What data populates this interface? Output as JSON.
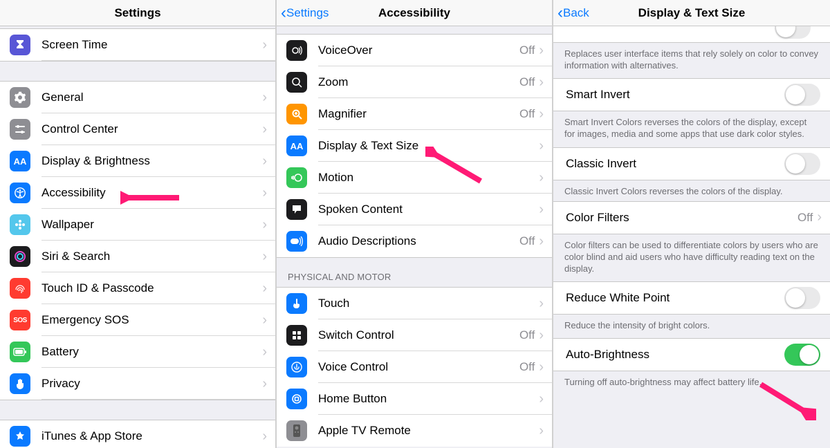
{
  "panes": {
    "settings": {
      "title": "Settings",
      "rows": {
        "screen_time": {
          "label": "Screen Time",
          "icon_bg": "#5856d6"
        },
        "general": {
          "label": "General",
          "icon_bg": "#8e8e93"
        },
        "control_center": {
          "label": "Control Center",
          "icon_bg": "#8e8e93"
        },
        "display_brightness": {
          "label": "Display & Brightness",
          "icon_bg": "#0a7aff"
        },
        "accessibility": {
          "label": "Accessibility",
          "icon_bg": "#0a7aff"
        },
        "wallpaper": {
          "label": "Wallpaper",
          "icon_bg": "#54c7ec"
        },
        "siri_search": {
          "label": "Siri & Search",
          "icon_bg": "#1c1c1e"
        },
        "touchid_passcode": {
          "label": "Touch ID & Passcode",
          "icon_bg": "#ff3b30"
        },
        "emergency_sos": {
          "label": "Emergency SOS",
          "icon_bg": "#ff3b30"
        },
        "battery": {
          "label": "Battery",
          "icon_bg": "#34c759"
        },
        "privacy": {
          "label": "Privacy",
          "icon_bg": "#0a7aff"
        },
        "itunes_appstore": {
          "label": "iTunes & App Store",
          "icon_bg": "#0a7aff"
        }
      }
    },
    "accessibility": {
      "nav_back": "Settings",
      "title": "Accessibility",
      "section_physical": "PHYSICAL AND MOTOR",
      "rows": {
        "voiceover": {
          "label": "VoiceOver",
          "value": "Off",
          "icon_bg": "#1c1c1e"
        },
        "zoom": {
          "label": "Zoom",
          "value": "Off",
          "icon_bg": "#1c1c1e"
        },
        "magnifier": {
          "label": "Magnifier",
          "value": "Off",
          "icon_bg": "#ff9500"
        },
        "display_text": {
          "label": "Display & Text Size",
          "value": "",
          "icon_bg": "#0a7aff"
        },
        "motion": {
          "label": "Motion",
          "value": "",
          "icon_bg": "#34c759"
        },
        "spoken_content": {
          "label": "Spoken Content",
          "value": "",
          "icon_bg": "#1c1c1e"
        },
        "audio_descriptions": {
          "label": "Audio Descriptions",
          "value": "Off",
          "icon_bg": "#0a7aff"
        },
        "touch": {
          "label": "Touch",
          "value": "",
          "icon_bg": "#0a7aff"
        },
        "switch_control": {
          "label": "Switch Control",
          "value": "Off",
          "icon_bg": "#1c1c1e"
        },
        "voice_control": {
          "label": "Voice Control",
          "value": "Off",
          "icon_bg": "#0a7aff"
        },
        "home_button": {
          "label": "Home Button",
          "value": "",
          "icon_bg": "#0a7aff"
        },
        "apple_tv_remote": {
          "label": "Apple TV Remote",
          "value": "",
          "icon_bg": "#8e8e93"
        }
      }
    },
    "display_text": {
      "nav_back": "Back",
      "title": "Display & Text Size",
      "differentiate_footer": "Replaces user interface items that rely solely on color to convey information with alternatives.",
      "smart_invert": {
        "label": "Smart Invert",
        "on": false
      },
      "smart_invert_footer": "Smart Invert Colors reverses the colors of the display, except for images, media and some apps that use dark color styles.",
      "classic_invert": {
        "label": "Classic Invert",
        "on": false
      },
      "classic_invert_footer": "Classic Invert Colors reverses the colors of the display.",
      "color_filters": {
        "label": "Color Filters",
        "value": "Off"
      },
      "color_filters_footer": "Color filters can be used to differentiate colors by users who are color blind and aid users who have difficulty reading text on the display.",
      "reduce_white_point": {
        "label": "Reduce White Point",
        "on": false
      },
      "reduce_white_point_footer": "Reduce the intensity of bright colors.",
      "auto_brightness": {
        "label": "Auto-Brightness",
        "on": true
      },
      "auto_brightness_footer": "Turning off auto-brightness may affect battery life."
    }
  }
}
